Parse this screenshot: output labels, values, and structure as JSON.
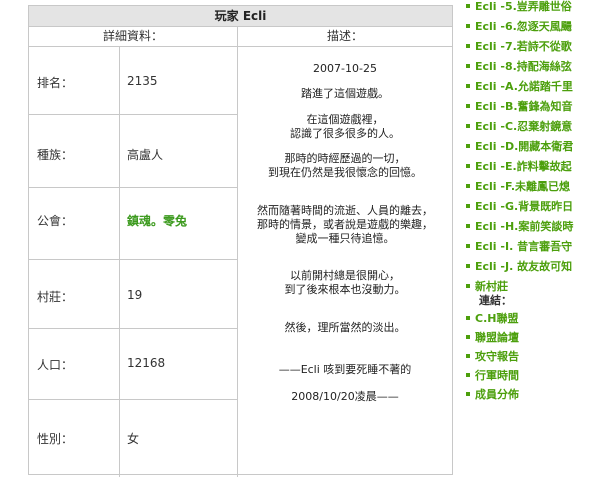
{
  "profile": {
    "title": "玩家 Ecli",
    "left_header": "詳細資料：",
    "right_header": "描述：",
    "rows": [
      {
        "label": "排名：",
        "value": "2135"
      },
      {
        "label": "種族：",
        "value": "高盧人"
      },
      {
        "label": "公會：",
        "value": "鎮魂。零兔"
      },
      {
        "label": "村莊：",
        "value": "19"
      },
      {
        "label": "人口：",
        "value": "12168"
      },
      {
        "label": "性別：",
        "value": "女"
      }
    ],
    "description": [
      "2007-10-25",
      "踏進了這個遊戲。",
      "在這個遊戲裡，\n認識了很多很多的人。",
      "那時的時經歷過的一切，\n到現在仍然是我很懷念的回憶。",
      "然而隨著時間的流逝、人員的離去，\n那時的情景，或者說是遊戲的樂趣，\n變成一種只待追憶。",
      "以前開村總是很開心，\n到了後來根本也沒動力。",
      "然後，理所當然的淡出。",
      "——Ecli 咳到要死睡不著的",
      "2008/10/20凌晨——"
    ]
  },
  "sidebar": {
    "villages": [
      "Ecli -5.豈弄雕世俗",
      "Ecli -6.忽逐天風颺",
      "Ecli -7.若詩不從歌",
      "Ecli -8.持配海絲弦",
      "Ecli -A.允諾踏千里",
      "Ecli -B.奮鋒為知音",
      "Ecli -C.忍棄射鏡意",
      "Ecli -D.開藏本衛君",
      "Ecli -E.詐料擊故起",
      "Ecli -F.未離鳳已熄",
      "Ecli -G.背景既昨日",
      "Ecli -H.案前笑談時",
      "Ecli -I. 昔言審吾守",
      "Ecli -J. 故友故可知",
      "新村莊"
    ],
    "links_header": "連結：",
    "links": [
      "C.H聯盟",
      "聯盟論壇",
      "攻守報告",
      "行軍時間",
      "成員分佈"
    ]
  }
}
